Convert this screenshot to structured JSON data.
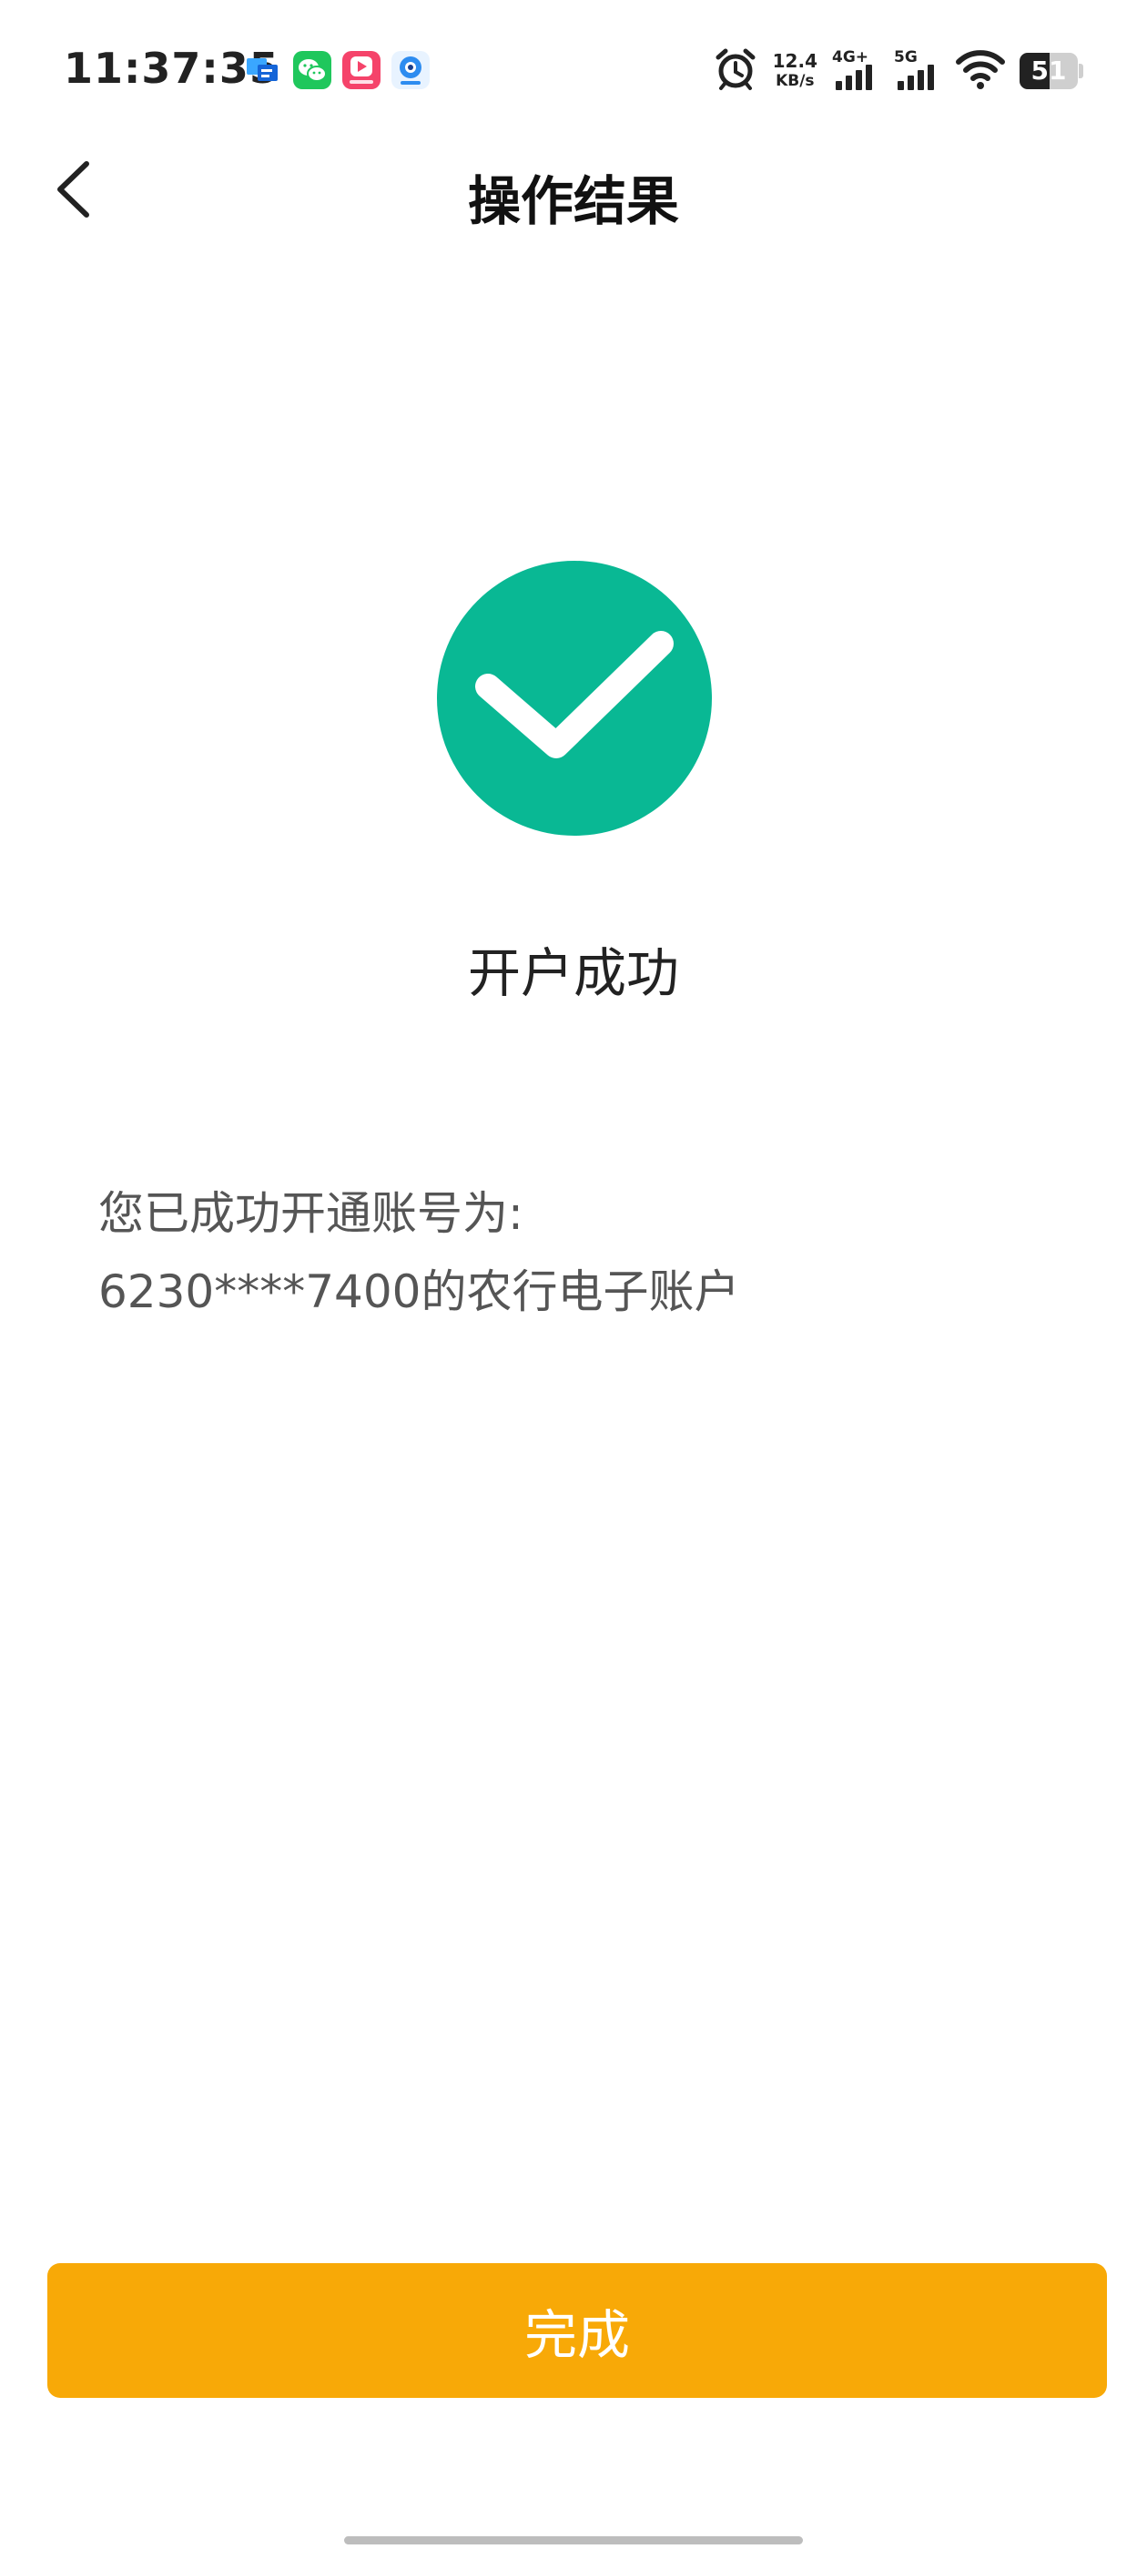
{
  "status_bar": {
    "time": "11:37:35",
    "notification_icons": [
      "message-app-icon",
      "wechat-icon",
      "video-app-icon",
      "camera-app-icon"
    ],
    "alarm_icon": "alarm-clock-icon",
    "net_speed_value": "12.4",
    "net_speed_unit": "KB/s",
    "signal_1_label": "4G+",
    "signal_2_label": "5G",
    "wifi_icon": "wifi-icon",
    "battery_level": "51"
  },
  "header": {
    "title": "操作结果",
    "back_icon": "chevron-left-icon"
  },
  "result": {
    "icon": "check-circle-icon",
    "icon_color": "#09b894",
    "title": "开户成功",
    "message_line1": "您已成功开通账号为:",
    "message_line2": "6230****7400的农行电子账户"
  },
  "footer": {
    "done_label": "完成",
    "button_color": "#f8a907"
  }
}
